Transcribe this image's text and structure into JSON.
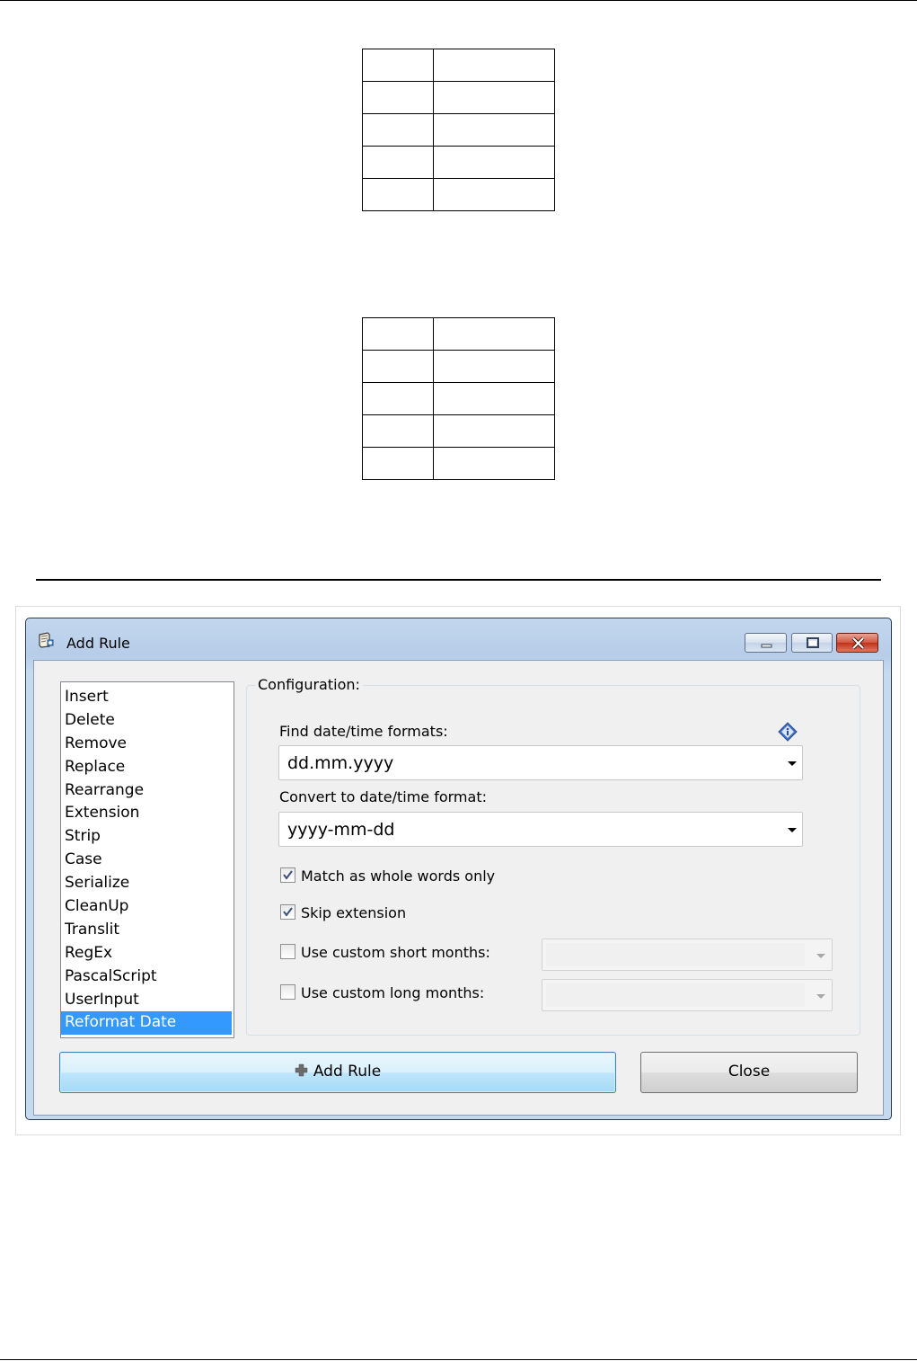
{
  "window": {
    "title": "Add Rule",
    "buttons": [
      "minimize",
      "maximize",
      "close"
    ]
  },
  "rules_list": {
    "items": [
      "Insert",
      "Delete",
      "Remove",
      "Replace",
      "Rearrange",
      "Extension",
      "Strip",
      "Case",
      "Serialize",
      "CleanUp",
      "Translit",
      "RegEx",
      "PascalScript",
      "UserInput",
      "Reformat Date"
    ],
    "selected": "Reformat Date"
  },
  "config": {
    "group_label": "Configuration:",
    "find_label": "Find date/time formats:",
    "find_value": "dd.mm.yyyy",
    "convert_label": "Convert to date/time format:",
    "convert_value": "yyyy-mm-dd",
    "match_whole_words": {
      "label": "Match as whole words only",
      "checked": true
    },
    "skip_extension": {
      "label": "Skip extension",
      "checked": true
    },
    "custom_short_months": {
      "label": "Use custom short months:",
      "checked": false,
      "value": ""
    },
    "custom_long_months": {
      "label": "Use custom long months:",
      "checked": false,
      "value": ""
    }
  },
  "actions": {
    "add_rule_label": "Add Rule",
    "close_label": "Close"
  },
  "icons": {
    "app": "add-rule-app-icon",
    "info": "info-icon",
    "plus": "plus-icon"
  },
  "colors": {
    "selection": "#3399ff",
    "titlebar": "#b7cde8",
    "close_button": "#c0321a"
  }
}
